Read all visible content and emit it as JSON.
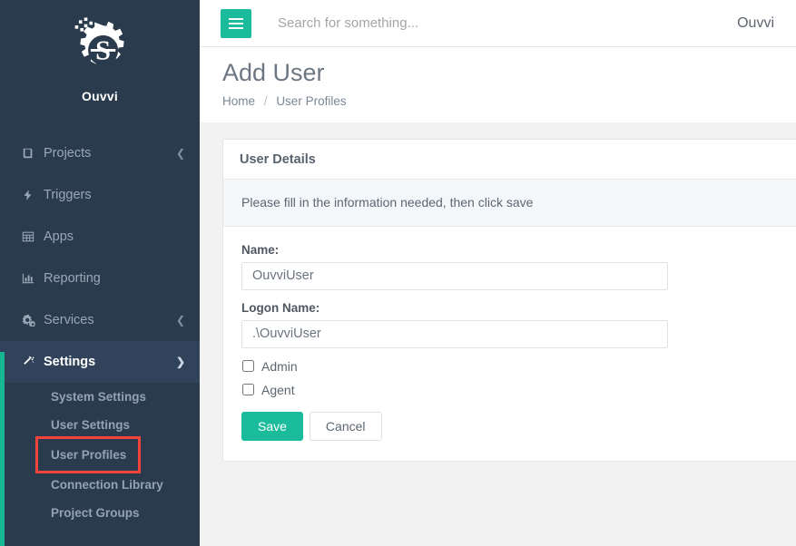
{
  "colors": {
    "accent": "#1abc9c",
    "sidebar_bg": "#2a3b4d",
    "sidebar_active_bg": "#30435a",
    "highlight_outline": "#f4433a",
    "page_bg": "#f2f2f2",
    "note_bg": "#f4f7fa"
  },
  "sidebar": {
    "brand": {
      "logo_icon": "gear-s-logo",
      "name": "Ouvvi"
    },
    "items": [
      {
        "label": "Projects",
        "icon": "book-icon",
        "chevron": "chevron-left-icon",
        "active": false
      },
      {
        "label": "Triggers",
        "icon": "bolt-icon",
        "chevron": "",
        "active": false
      },
      {
        "label": "Apps",
        "icon": "grid-icon",
        "chevron": "",
        "active": false
      },
      {
        "label": "Reporting",
        "icon": "bar-chart-icon",
        "chevron": "",
        "active": false
      },
      {
        "label": "Services",
        "icon": "gears-icon",
        "chevron": "chevron-left-icon",
        "active": false
      },
      {
        "label": "Settings",
        "icon": "magic-wand-icon",
        "chevron": "chevron-down-icon",
        "active": true
      }
    ],
    "submenu": [
      {
        "label": "System Settings",
        "highlighted": false
      },
      {
        "label": "User Settings",
        "highlighted": false
      },
      {
        "label": "User Profiles",
        "highlighted": true
      },
      {
        "label": "Connection Library",
        "highlighted": false
      },
      {
        "label": "Project Groups",
        "highlighted": false
      }
    ]
  },
  "topbar": {
    "menu_icon": "hamburger-icon",
    "search_placeholder": "Search for something...",
    "search_value": "",
    "user": "Ouvvi"
  },
  "page": {
    "title": "Add User",
    "breadcrumb": {
      "home": "Home",
      "separator": "/",
      "current": "User Profiles"
    }
  },
  "card": {
    "header": "User Details",
    "note": "Please fill in the information needed, then click save",
    "fields": [
      {
        "label": "Name:",
        "value": "OuvviUser",
        "placeholder": ""
      },
      {
        "label": "Logon Name:",
        "value": ".\\OuvviUser",
        "placeholder": ""
      }
    ],
    "checkboxes": [
      {
        "label": "Admin",
        "checked": false
      },
      {
        "label": "Agent",
        "checked": false
      }
    ],
    "buttons": {
      "save": "Save",
      "cancel": "Cancel"
    }
  }
}
